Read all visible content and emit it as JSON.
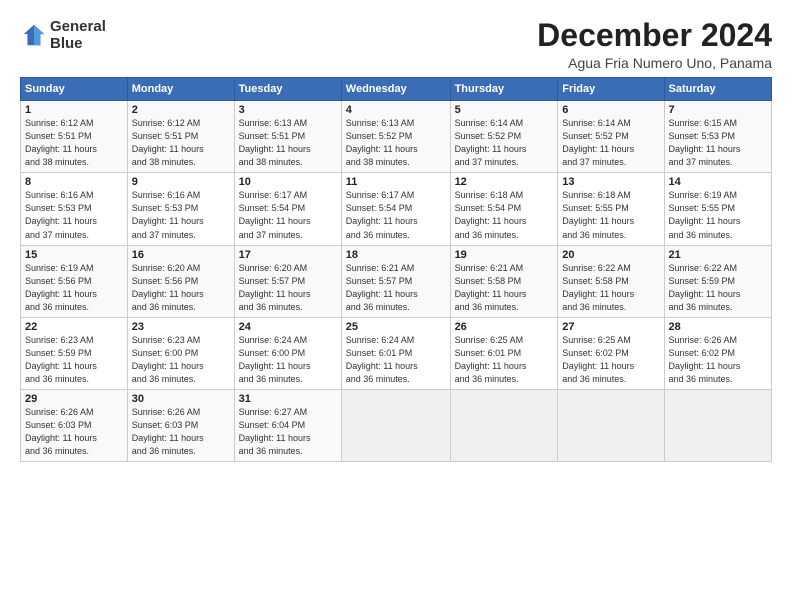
{
  "logo": {
    "line1": "General",
    "line2": "Blue"
  },
  "title": "December 2024",
  "subtitle": "Agua Fria Numero Uno, Panama",
  "days_header": [
    "Sunday",
    "Monday",
    "Tuesday",
    "Wednesday",
    "Thursday",
    "Friday",
    "Saturday"
  ],
  "weeks": [
    [
      {
        "day": "1",
        "info": "Sunrise: 6:12 AM\nSunset: 5:51 PM\nDaylight: 11 hours\nand 38 minutes."
      },
      {
        "day": "2",
        "info": "Sunrise: 6:12 AM\nSunset: 5:51 PM\nDaylight: 11 hours\nand 38 minutes."
      },
      {
        "day": "3",
        "info": "Sunrise: 6:13 AM\nSunset: 5:51 PM\nDaylight: 11 hours\nand 38 minutes."
      },
      {
        "day": "4",
        "info": "Sunrise: 6:13 AM\nSunset: 5:52 PM\nDaylight: 11 hours\nand 38 minutes."
      },
      {
        "day": "5",
        "info": "Sunrise: 6:14 AM\nSunset: 5:52 PM\nDaylight: 11 hours\nand 37 minutes."
      },
      {
        "day": "6",
        "info": "Sunrise: 6:14 AM\nSunset: 5:52 PM\nDaylight: 11 hours\nand 37 minutes."
      },
      {
        "day": "7",
        "info": "Sunrise: 6:15 AM\nSunset: 5:53 PM\nDaylight: 11 hours\nand 37 minutes."
      }
    ],
    [
      {
        "day": "8",
        "info": "Sunrise: 6:16 AM\nSunset: 5:53 PM\nDaylight: 11 hours\nand 37 minutes."
      },
      {
        "day": "9",
        "info": "Sunrise: 6:16 AM\nSunset: 5:53 PM\nDaylight: 11 hours\nand 37 minutes."
      },
      {
        "day": "10",
        "info": "Sunrise: 6:17 AM\nSunset: 5:54 PM\nDaylight: 11 hours\nand 37 minutes."
      },
      {
        "day": "11",
        "info": "Sunrise: 6:17 AM\nSunset: 5:54 PM\nDaylight: 11 hours\nand 36 minutes."
      },
      {
        "day": "12",
        "info": "Sunrise: 6:18 AM\nSunset: 5:54 PM\nDaylight: 11 hours\nand 36 minutes."
      },
      {
        "day": "13",
        "info": "Sunrise: 6:18 AM\nSunset: 5:55 PM\nDaylight: 11 hours\nand 36 minutes."
      },
      {
        "day": "14",
        "info": "Sunrise: 6:19 AM\nSunset: 5:55 PM\nDaylight: 11 hours\nand 36 minutes."
      }
    ],
    [
      {
        "day": "15",
        "info": "Sunrise: 6:19 AM\nSunset: 5:56 PM\nDaylight: 11 hours\nand 36 minutes."
      },
      {
        "day": "16",
        "info": "Sunrise: 6:20 AM\nSunset: 5:56 PM\nDaylight: 11 hours\nand 36 minutes."
      },
      {
        "day": "17",
        "info": "Sunrise: 6:20 AM\nSunset: 5:57 PM\nDaylight: 11 hours\nand 36 minutes."
      },
      {
        "day": "18",
        "info": "Sunrise: 6:21 AM\nSunset: 5:57 PM\nDaylight: 11 hours\nand 36 minutes."
      },
      {
        "day": "19",
        "info": "Sunrise: 6:21 AM\nSunset: 5:58 PM\nDaylight: 11 hours\nand 36 minutes."
      },
      {
        "day": "20",
        "info": "Sunrise: 6:22 AM\nSunset: 5:58 PM\nDaylight: 11 hours\nand 36 minutes."
      },
      {
        "day": "21",
        "info": "Sunrise: 6:22 AM\nSunset: 5:59 PM\nDaylight: 11 hours\nand 36 minutes."
      }
    ],
    [
      {
        "day": "22",
        "info": "Sunrise: 6:23 AM\nSunset: 5:59 PM\nDaylight: 11 hours\nand 36 minutes."
      },
      {
        "day": "23",
        "info": "Sunrise: 6:23 AM\nSunset: 6:00 PM\nDaylight: 11 hours\nand 36 minutes."
      },
      {
        "day": "24",
        "info": "Sunrise: 6:24 AM\nSunset: 6:00 PM\nDaylight: 11 hours\nand 36 minutes."
      },
      {
        "day": "25",
        "info": "Sunrise: 6:24 AM\nSunset: 6:01 PM\nDaylight: 11 hours\nand 36 minutes."
      },
      {
        "day": "26",
        "info": "Sunrise: 6:25 AM\nSunset: 6:01 PM\nDaylight: 11 hours\nand 36 minutes."
      },
      {
        "day": "27",
        "info": "Sunrise: 6:25 AM\nSunset: 6:02 PM\nDaylight: 11 hours\nand 36 minutes."
      },
      {
        "day": "28",
        "info": "Sunrise: 6:26 AM\nSunset: 6:02 PM\nDaylight: 11 hours\nand 36 minutes."
      }
    ],
    [
      {
        "day": "29",
        "info": "Sunrise: 6:26 AM\nSunset: 6:03 PM\nDaylight: 11 hours\nand 36 minutes."
      },
      {
        "day": "30",
        "info": "Sunrise: 6:26 AM\nSunset: 6:03 PM\nDaylight: 11 hours\nand 36 minutes."
      },
      {
        "day": "31",
        "info": "Sunrise: 6:27 AM\nSunset: 6:04 PM\nDaylight: 11 hours\nand 36 minutes."
      },
      {
        "day": "",
        "info": ""
      },
      {
        "day": "",
        "info": ""
      },
      {
        "day": "",
        "info": ""
      },
      {
        "day": "",
        "info": ""
      }
    ]
  ]
}
